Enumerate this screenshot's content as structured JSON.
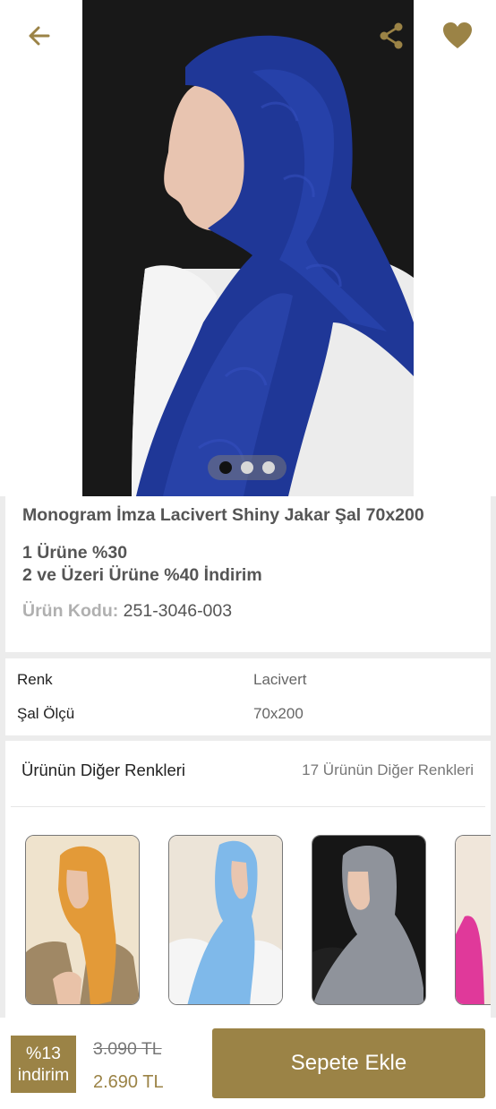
{
  "product": {
    "title": "Monogram İmza Lacivert Shiny Jakar Şal 70x200",
    "promo_line1": "1 Ürüne %30",
    "promo_line2": "2 ve Üzeri Ürüne %40 İndirim",
    "code_label": "Ürün Kodu:",
    "code_value": "251-3046-003",
    "colors": {
      "accent": "#9b8346",
      "scarf": "#1e3596"
    }
  },
  "gallery": {
    "slide_count": 3,
    "active_slide": 1
  },
  "attributes": [
    {
      "label": "Renk",
      "value": "Lacivert"
    },
    {
      "label": "Şal Ölçü",
      "value": "70x200"
    }
  ],
  "other_colors": {
    "heading": "Ürünün Diğer Renkleri",
    "link": "17 Ürünün Diğer Renkleri",
    "thumbnails": [
      {
        "color": "orange",
        "hex": "#e39a38"
      },
      {
        "color": "light-blue",
        "hex": "#7fb9ea"
      },
      {
        "color": "grey",
        "hex": "#8f939b"
      },
      {
        "color": "pink",
        "hex": "#e0399a"
      }
    ]
  },
  "bottom_bar": {
    "badge_line1": "%13",
    "badge_line2": "indirim",
    "old_price": "3.090 TL",
    "new_price": "2.690 TL",
    "cart_button": "Sepete Ekle"
  },
  "icons": {
    "back": "arrow-left-icon",
    "share": "share-icon",
    "favorite": "heart-icon"
  }
}
